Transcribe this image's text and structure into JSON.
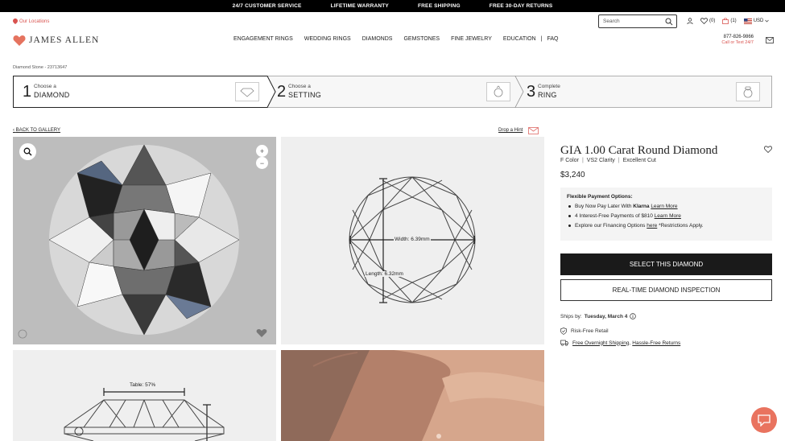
{
  "topbar": [
    "24/7 CUSTOMER SERVICE",
    "LIFETIME WARRANTY",
    "FREE SHIPPING",
    "FREE 30-DAY RETURNS"
  ],
  "header": {
    "locations": "Our Locations",
    "logo": "JAMES ALLEN",
    "search_placeholder": "Search",
    "wishlist_count": "(0)",
    "cart_count": "(1)",
    "currency": "USD",
    "phone": "877-826-9866",
    "phone_sub": "Call or Text 24/7"
  },
  "nav": [
    "ENGAGEMENT RINGS",
    "WEDDING RINGS",
    "DIAMONDS",
    "GEMSTONES",
    "FINE JEWELRY",
    "EDUCATION",
    "|",
    "FAQ"
  ],
  "breadcrumb": "Diamond Stone - 23713647",
  "steps": [
    {
      "num": "1",
      "small": "Choose a",
      "big": "DIAMOND"
    },
    {
      "num": "2",
      "small": "Choose a",
      "big": "SETTING"
    },
    {
      "num": "3",
      "small": "Complete",
      "big": "RING"
    }
  ],
  "gallery": {
    "back": "BACK TO GALLERY",
    "hint": "Drop a Hint",
    "width_label": "Width: 6.39mm",
    "length_label": "Length: 6.32mm",
    "table_label": "Table: 57%"
  },
  "product": {
    "title": "GIA 1.00 Carat Round Diamond",
    "color": "F Color",
    "clarity": "VS2 Clarity",
    "cut": "Excellent Cut",
    "price": "$3,240"
  },
  "payment": {
    "heading": "Flexible Payment Options:",
    "line1_pre": "Buy Now Pay Later With",
    "line1_brand": "Klarna",
    "line1_link": "Learn More",
    "line2_pre": "4 Interest-Free Payments of $810",
    "line2_link": "Learn More",
    "line3_pre": "Explore our Financing Options",
    "line3_link": "here",
    "line3_post": "*Restrictions Apply."
  },
  "actions": {
    "select": "SELECT THIS DIAMOND",
    "inspection": "REAL-TIME DIAMOND INSPECTION"
  },
  "shipping": {
    "ships_label": "Ships by:",
    "ships_date": "Tuesday, March 4",
    "risk_free": "Risk-Free Retail",
    "free_shipping": "Free Overnight Shipping",
    "returns": "Hassle-Free Returns"
  }
}
